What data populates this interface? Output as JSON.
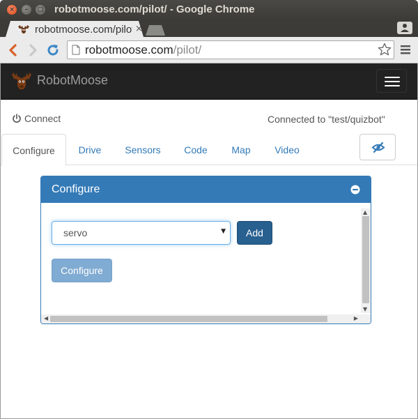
{
  "window": {
    "title": "robotmoose.com/pilot/ - Google Chrome",
    "controls": [
      "close",
      "minimize",
      "maximize"
    ],
    "close_glyph": "×",
    "min_glyph": "–",
    "max_glyph": "□"
  },
  "browser": {
    "tab_title": "robotmoose.com/pilot/",
    "tab_close_glyph": "×",
    "url_host": "robotmoose.com",
    "url_path": "/pilot/"
  },
  "app": {
    "brand": "RobotMoose",
    "connect_label": "Connect",
    "connected_status": "Connected to \"test/quizbot\"",
    "tabs": [
      {
        "label": "Configure",
        "active": true
      },
      {
        "label": "Drive",
        "active": false
      },
      {
        "label": "Sensors",
        "active": false
      },
      {
        "label": "Code",
        "active": false
      },
      {
        "label": "Map",
        "active": false
      },
      {
        "label": "Video",
        "active": false
      }
    ],
    "panel": {
      "title": "Configure",
      "select_value": "servo",
      "select_arrow": "▼",
      "add_label": "Add",
      "configure_label": "Configure"
    },
    "scroll_glyphs": {
      "up": "▲",
      "down": "▼",
      "left": "◀",
      "right": "▶"
    }
  },
  "colors": {
    "primary": "#337ab7",
    "primary_dark": "#286090",
    "navbar": "#222222",
    "link": "#337ab7",
    "close_button": "#df4a16"
  },
  "icons": {
    "page": "page-icon",
    "back": "back-arrow-icon",
    "forward": "forward-arrow-icon",
    "reload": "reload-icon",
    "star": "bookmark-star-icon",
    "menu": "hamburger-menu-icon",
    "power": "power-icon",
    "eye": "eye-visibility-icon",
    "collapse": "minus-circle-icon",
    "logo": "moose-logo-icon"
  }
}
